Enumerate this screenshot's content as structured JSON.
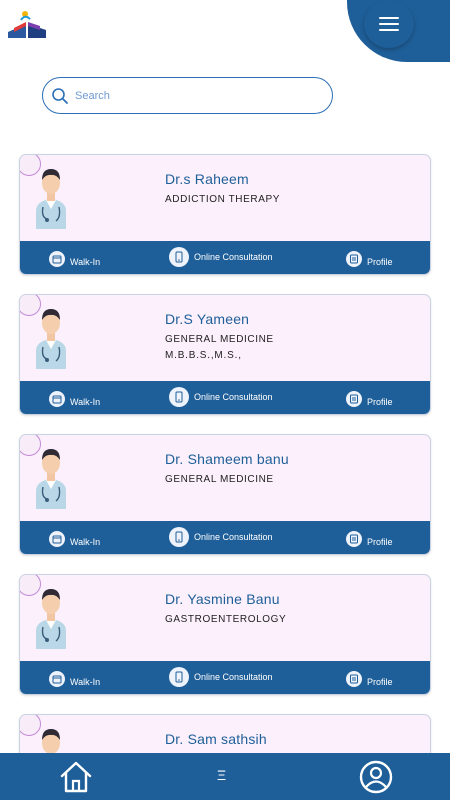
{
  "header": {
    "logo_icon": "open-book-logo-icon",
    "menu_icon": "hamburger-menu-icon"
  },
  "search": {
    "placeholder": "Search",
    "icon": "search-icon"
  },
  "actions": {
    "walk_in": "Walk-In",
    "online": "Online Consultation",
    "profile": "Profile"
  },
  "doctors": [
    {
      "name": "Dr.s Raheem",
      "specialty": "ADDICTION THERAPY",
      "qualification": ""
    },
    {
      "name": "Dr.S Yameen",
      "specialty": "GENERAL MEDICINE",
      "qualification": "M.B.B.S.,M.S.,"
    },
    {
      "name": "Dr. Shameem banu",
      "specialty": "GENERAL MEDICINE",
      "qualification": ""
    },
    {
      "name": "Dr. Yasmine Banu",
      "specialty": "GASTROENTEROLOGY",
      "qualification": ""
    },
    {
      "name": "Dr. Sam sathsih",
      "specialty": "",
      "qualification": ""
    }
  ],
  "bottom_nav": {
    "home_icon": "home-icon",
    "middle_label": "Ξ",
    "profile_icon": "user-profile-icon"
  },
  "colors": {
    "primary": "#1f5f99",
    "card_bg": "#fbf0fb",
    "name_text": "#1f5f99"
  }
}
